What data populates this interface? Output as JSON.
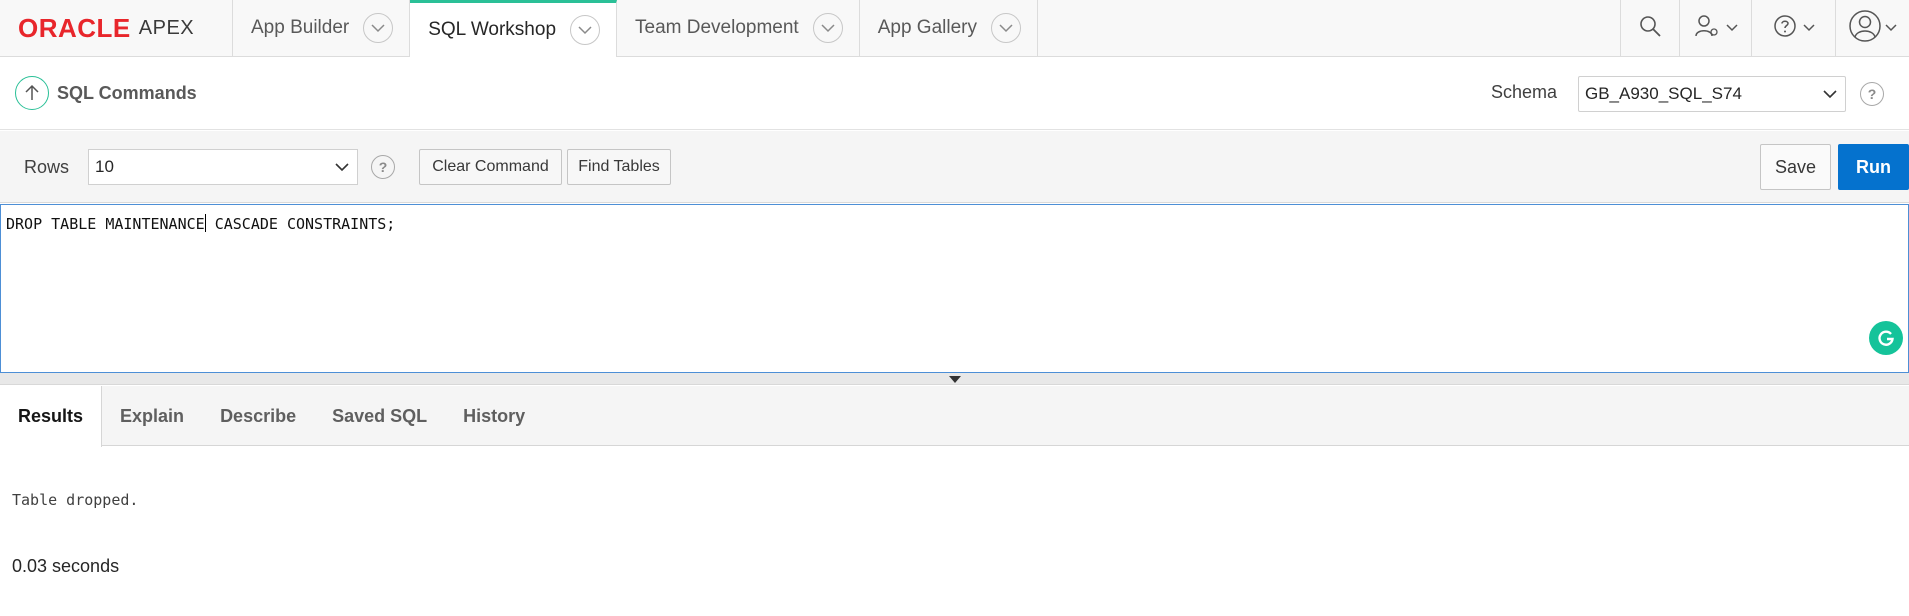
{
  "brand": {
    "name": "ORACLE",
    "product": "APEX",
    "color": "#e8262b"
  },
  "nav": {
    "tabs": [
      {
        "label": "App Builder",
        "active": false
      },
      {
        "label": "SQL Workshop",
        "active": true
      },
      {
        "label": "Team Development",
        "active": false
      },
      {
        "label": "App Gallery",
        "active": false
      }
    ],
    "tools": [
      "search-icon",
      "user-admin-icon",
      "help-icon",
      "account-icon"
    ],
    "active_accent": "#2ac097"
  },
  "page": {
    "title": "SQL Commands",
    "schema_label": "Schema",
    "schema_value": "GB_A930_SQL_S74",
    "help_glyph": "?"
  },
  "toolbar": {
    "rows_label": "Rows",
    "rows_value": "10",
    "clear_label": "Clear Command",
    "find_label": "Find Tables",
    "save_label": "Save",
    "run_label": "Run",
    "run_color": "#0572ce"
  },
  "editor": {
    "text_before_caret": "DROP TABLE MAINTENANCE",
    "text_after_caret": " CASCADE CONSTRAINTS;"
  },
  "results": {
    "tabs": [
      {
        "label": "Results",
        "active": true
      },
      {
        "label": "Explain",
        "active": false
      },
      {
        "label": "Describe",
        "active": false
      },
      {
        "label": "Saved SQL",
        "active": false
      },
      {
        "label": "History",
        "active": false
      }
    ],
    "message": "Table dropped.",
    "elapsed": "0.03 seconds"
  }
}
